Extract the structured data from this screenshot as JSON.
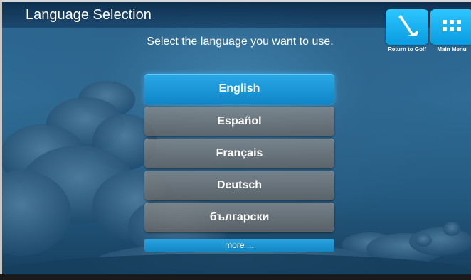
{
  "header": {
    "title": "Language Selection",
    "subtitle": "Select the language you want to use."
  },
  "top_buttons": {
    "return_to_golf": {
      "label": "Return to Golf",
      "icon": "golf-club-icon"
    },
    "main_menu": {
      "label": "Main Menu",
      "icon": "grid-menu-icon"
    }
  },
  "languages": [
    {
      "label": "English",
      "selected": true
    },
    {
      "label": "Español",
      "selected": false
    },
    {
      "label": "Français",
      "selected": false
    },
    {
      "label": "Deutsch",
      "selected": false
    },
    {
      "label": "български",
      "selected": false
    }
  ],
  "more": {
    "label": "more ..."
  },
  "colors": {
    "accent": "#0a9be0",
    "selected": "#1a96d6",
    "unselected": "#7a7a7a"
  }
}
